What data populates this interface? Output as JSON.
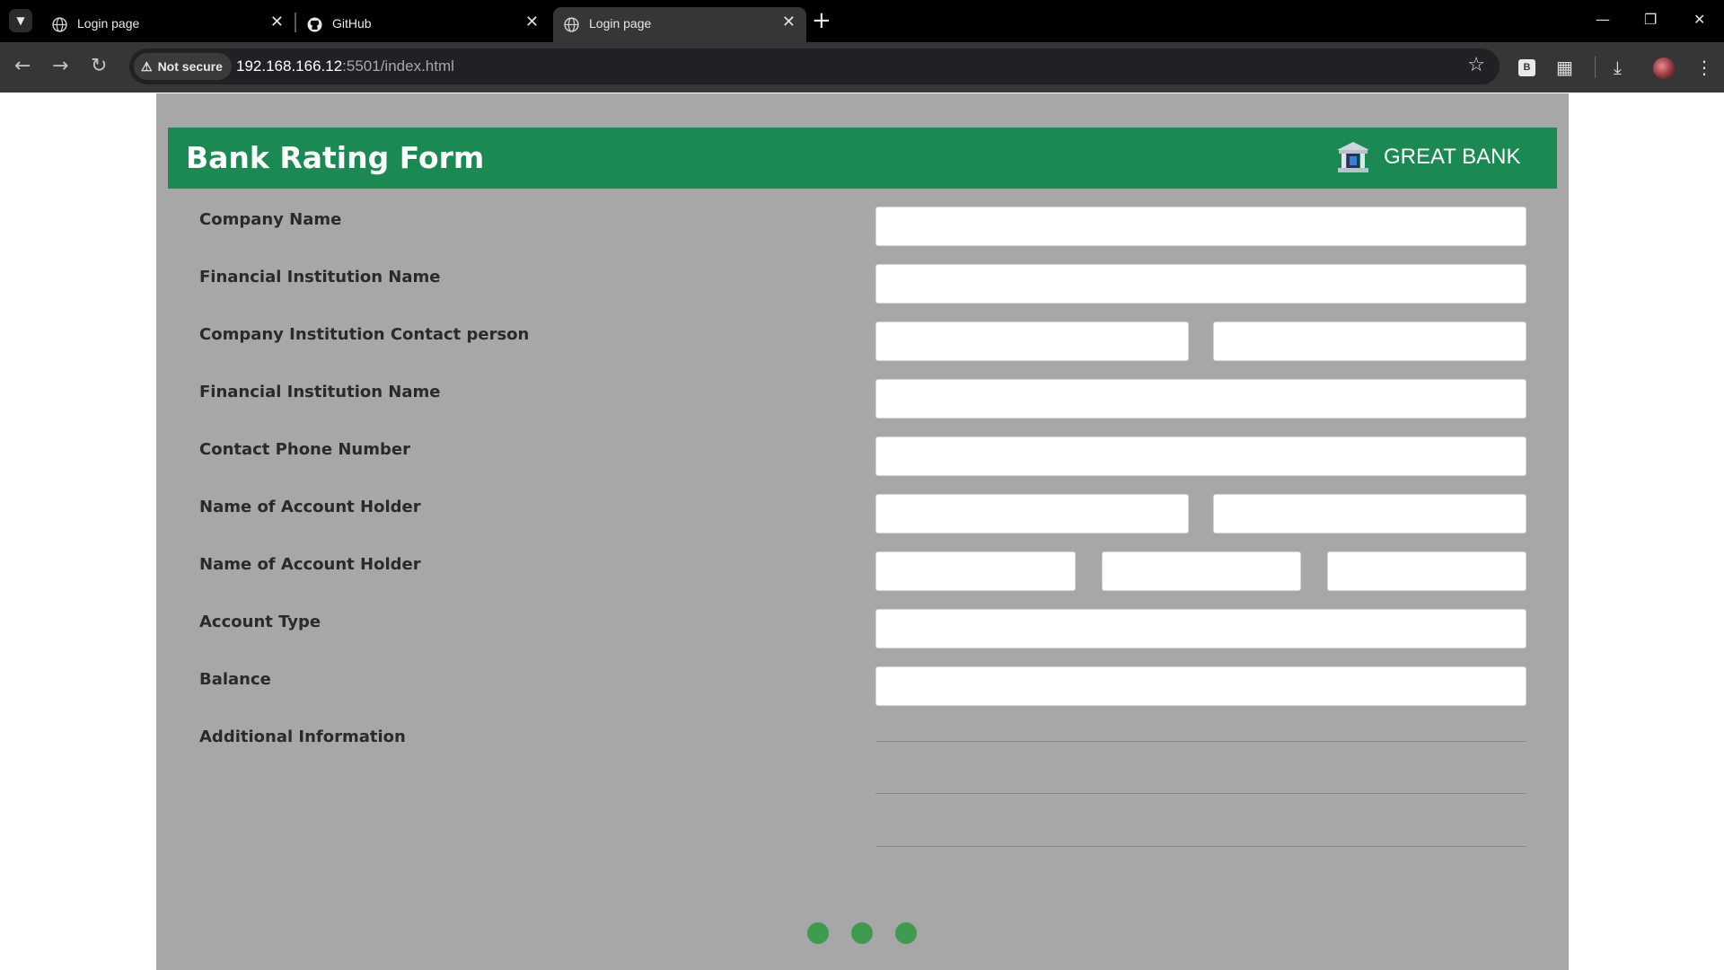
{
  "browser": {
    "tabs": [
      {
        "title": "Login page",
        "icon": "globe-icon",
        "active": false
      },
      {
        "title": "GitHub",
        "icon": "github-icon",
        "active": false
      },
      {
        "title": "Login page",
        "icon": "globe-icon",
        "active": true
      }
    ],
    "security_label": "Not secure",
    "url_host": "192.168.166.12",
    "url_rest": ":5501/index.html"
  },
  "form": {
    "title": "Bank Rating Form",
    "brand_name": "GREAT BANK",
    "brand_color": "#1a8a52",
    "fields": [
      {
        "label": "Company Name"
      },
      {
        "label": "Financial Institution Name"
      },
      {
        "label": "Company Institution Contact person"
      },
      {
        "label": "Financial Institution Name"
      },
      {
        "label": "Contact Phone Number"
      },
      {
        "label": "Name of Account Holder"
      },
      {
        "label": "Name of Account Holder"
      },
      {
        "label": "Account Type"
      },
      {
        "label": "Balance"
      },
      {
        "label": "Additional Information"
      }
    ],
    "pager_dots": 3,
    "dot_color": "#3d9a4f"
  }
}
